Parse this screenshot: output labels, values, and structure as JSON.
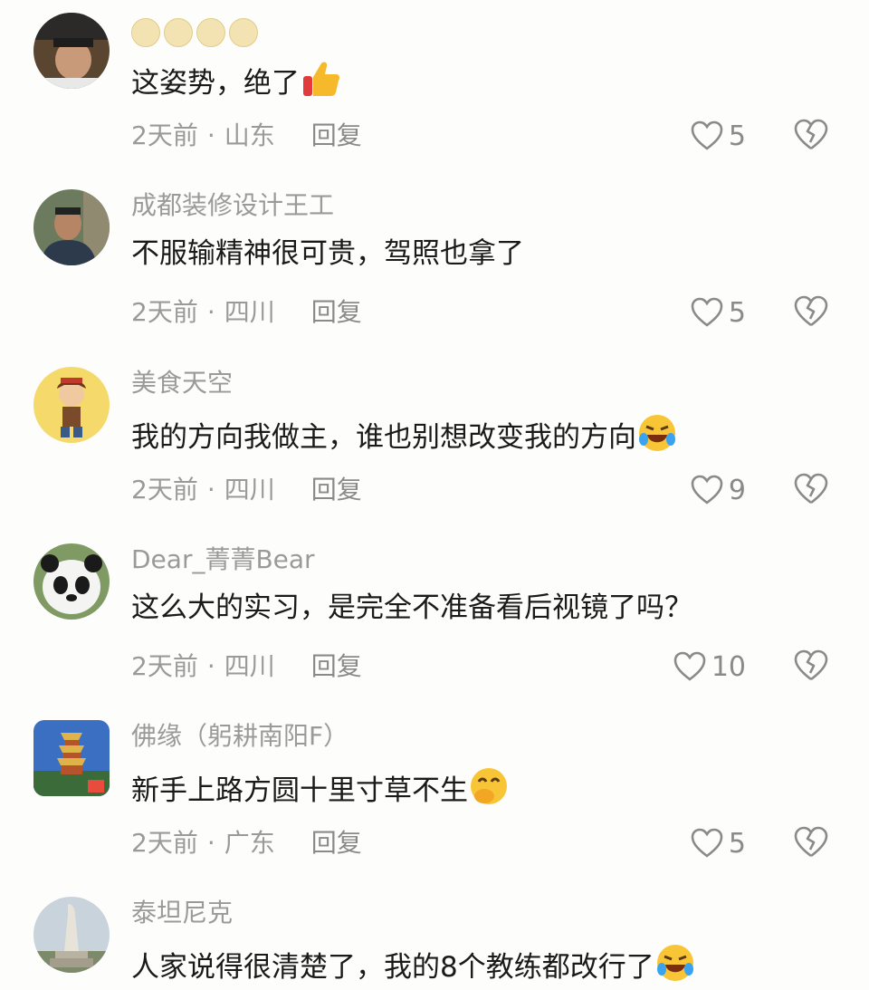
{
  "comments": [
    {
      "username": "",
      "text": "这姿势，绝了",
      "time": "2天前",
      "location": "山东",
      "reply": "回复",
      "likes": "5",
      "emoji": "thumbs-up"
    },
    {
      "username": "成都装修设计王工",
      "text": "不服输精神很可贵，驾照也拿了",
      "time": "2天前",
      "location": "四川",
      "reply": "回复",
      "likes": "5",
      "emoji": ""
    },
    {
      "username": "美食天空",
      "text": "我的方向我做主，谁也别想改变我的方向",
      "time": "2天前",
      "location": "四川",
      "reply": "回复",
      "likes": "9",
      "emoji": "laugh-cry"
    },
    {
      "username": "Dear_菁菁Bear",
      "text": "这么大的实习，是完全不准备看后视镜了吗？",
      "time": "2天前",
      "location": "四川",
      "reply": "回复",
      "likes": "10",
      "emoji": ""
    },
    {
      "username": "佛缘（躬耕南阳F）",
      "text": "新手上路方圆十里寸草不生",
      "time": "2天前",
      "location": "广东",
      "reply": "回复",
      "likes": "5",
      "emoji": "giggle"
    },
    {
      "username": "泰坦尼克",
      "text": "人家说得很清楚了，我的8个教练都改行了",
      "time": "",
      "location": "",
      "reply": "",
      "likes": "",
      "emoji": "laugh-cry"
    }
  ],
  "separator": "·",
  "icons": {
    "like": "heart-outline-icon",
    "dislike": "broken-heart-icon"
  },
  "colors": {
    "meta_text": "#9a9a9a",
    "body_text": "#1a1a1a",
    "icon": "#8a8a8a"
  }
}
